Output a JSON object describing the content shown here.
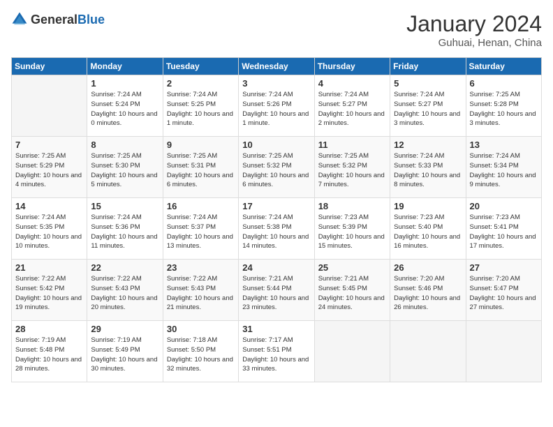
{
  "logo": {
    "general": "General",
    "blue": "Blue"
  },
  "header": {
    "month": "January 2024",
    "location": "Guhuai, Henan, China"
  },
  "weekdays": [
    "Sunday",
    "Monday",
    "Tuesday",
    "Wednesday",
    "Thursday",
    "Friday",
    "Saturday"
  ],
  "weeks": [
    [
      {
        "day": "",
        "sunrise": "",
        "sunset": "",
        "daylight": ""
      },
      {
        "day": "1",
        "sunrise": "Sunrise: 7:24 AM",
        "sunset": "Sunset: 5:24 PM",
        "daylight": "Daylight: 10 hours and 0 minutes."
      },
      {
        "day": "2",
        "sunrise": "Sunrise: 7:24 AM",
        "sunset": "Sunset: 5:25 PM",
        "daylight": "Daylight: 10 hours and 1 minute."
      },
      {
        "day": "3",
        "sunrise": "Sunrise: 7:24 AM",
        "sunset": "Sunset: 5:26 PM",
        "daylight": "Daylight: 10 hours and 1 minute."
      },
      {
        "day": "4",
        "sunrise": "Sunrise: 7:24 AM",
        "sunset": "Sunset: 5:27 PM",
        "daylight": "Daylight: 10 hours and 2 minutes."
      },
      {
        "day": "5",
        "sunrise": "Sunrise: 7:24 AM",
        "sunset": "Sunset: 5:27 PM",
        "daylight": "Daylight: 10 hours and 3 minutes."
      },
      {
        "day": "6",
        "sunrise": "Sunrise: 7:25 AM",
        "sunset": "Sunset: 5:28 PM",
        "daylight": "Daylight: 10 hours and 3 minutes."
      }
    ],
    [
      {
        "day": "7",
        "sunrise": "Sunrise: 7:25 AM",
        "sunset": "Sunset: 5:29 PM",
        "daylight": "Daylight: 10 hours and 4 minutes."
      },
      {
        "day": "8",
        "sunrise": "Sunrise: 7:25 AM",
        "sunset": "Sunset: 5:30 PM",
        "daylight": "Daylight: 10 hours and 5 minutes."
      },
      {
        "day": "9",
        "sunrise": "Sunrise: 7:25 AM",
        "sunset": "Sunset: 5:31 PM",
        "daylight": "Daylight: 10 hours and 6 minutes."
      },
      {
        "day": "10",
        "sunrise": "Sunrise: 7:25 AM",
        "sunset": "Sunset: 5:32 PM",
        "daylight": "Daylight: 10 hours and 6 minutes."
      },
      {
        "day": "11",
        "sunrise": "Sunrise: 7:25 AM",
        "sunset": "Sunset: 5:32 PM",
        "daylight": "Daylight: 10 hours and 7 minutes."
      },
      {
        "day": "12",
        "sunrise": "Sunrise: 7:24 AM",
        "sunset": "Sunset: 5:33 PM",
        "daylight": "Daylight: 10 hours and 8 minutes."
      },
      {
        "day": "13",
        "sunrise": "Sunrise: 7:24 AM",
        "sunset": "Sunset: 5:34 PM",
        "daylight": "Daylight: 10 hours and 9 minutes."
      }
    ],
    [
      {
        "day": "14",
        "sunrise": "Sunrise: 7:24 AM",
        "sunset": "Sunset: 5:35 PM",
        "daylight": "Daylight: 10 hours and 10 minutes."
      },
      {
        "day": "15",
        "sunrise": "Sunrise: 7:24 AM",
        "sunset": "Sunset: 5:36 PM",
        "daylight": "Daylight: 10 hours and 11 minutes."
      },
      {
        "day": "16",
        "sunrise": "Sunrise: 7:24 AM",
        "sunset": "Sunset: 5:37 PM",
        "daylight": "Daylight: 10 hours and 13 minutes."
      },
      {
        "day": "17",
        "sunrise": "Sunrise: 7:24 AM",
        "sunset": "Sunset: 5:38 PM",
        "daylight": "Daylight: 10 hours and 14 minutes."
      },
      {
        "day": "18",
        "sunrise": "Sunrise: 7:23 AM",
        "sunset": "Sunset: 5:39 PM",
        "daylight": "Daylight: 10 hours and 15 minutes."
      },
      {
        "day": "19",
        "sunrise": "Sunrise: 7:23 AM",
        "sunset": "Sunset: 5:40 PM",
        "daylight": "Daylight: 10 hours and 16 minutes."
      },
      {
        "day": "20",
        "sunrise": "Sunrise: 7:23 AM",
        "sunset": "Sunset: 5:41 PM",
        "daylight": "Daylight: 10 hours and 17 minutes."
      }
    ],
    [
      {
        "day": "21",
        "sunrise": "Sunrise: 7:22 AM",
        "sunset": "Sunset: 5:42 PM",
        "daylight": "Daylight: 10 hours and 19 minutes."
      },
      {
        "day": "22",
        "sunrise": "Sunrise: 7:22 AM",
        "sunset": "Sunset: 5:43 PM",
        "daylight": "Daylight: 10 hours and 20 minutes."
      },
      {
        "day": "23",
        "sunrise": "Sunrise: 7:22 AM",
        "sunset": "Sunset: 5:43 PM",
        "daylight": "Daylight: 10 hours and 21 minutes."
      },
      {
        "day": "24",
        "sunrise": "Sunrise: 7:21 AM",
        "sunset": "Sunset: 5:44 PM",
        "daylight": "Daylight: 10 hours and 23 minutes."
      },
      {
        "day": "25",
        "sunrise": "Sunrise: 7:21 AM",
        "sunset": "Sunset: 5:45 PM",
        "daylight": "Daylight: 10 hours and 24 minutes."
      },
      {
        "day": "26",
        "sunrise": "Sunrise: 7:20 AM",
        "sunset": "Sunset: 5:46 PM",
        "daylight": "Daylight: 10 hours and 26 minutes."
      },
      {
        "day": "27",
        "sunrise": "Sunrise: 7:20 AM",
        "sunset": "Sunset: 5:47 PM",
        "daylight": "Daylight: 10 hours and 27 minutes."
      }
    ],
    [
      {
        "day": "28",
        "sunrise": "Sunrise: 7:19 AM",
        "sunset": "Sunset: 5:48 PM",
        "daylight": "Daylight: 10 hours and 28 minutes."
      },
      {
        "day": "29",
        "sunrise": "Sunrise: 7:19 AM",
        "sunset": "Sunset: 5:49 PM",
        "daylight": "Daylight: 10 hours and 30 minutes."
      },
      {
        "day": "30",
        "sunrise": "Sunrise: 7:18 AM",
        "sunset": "Sunset: 5:50 PM",
        "daylight": "Daylight: 10 hours and 32 minutes."
      },
      {
        "day": "31",
        "sunrise": "Sunrise: 7:17 AM",
        "sunset": "Sunset: 5:51 PM",
        "daylight": "Daylight: 10 hours and 33 minutes."
      },
      {
        "day": "",
        "sunrise": "",
        "sunset": "",
        "daylight": ""
      },
      {
        "day": "",
        "sunrise": "",
        "sunset": "",
        "daylight": ""
      },
      {
        "day": "",
        "sunrise": "",
        "sunset": "",
        "daylight": ""
      }
    ]
  ]
}
